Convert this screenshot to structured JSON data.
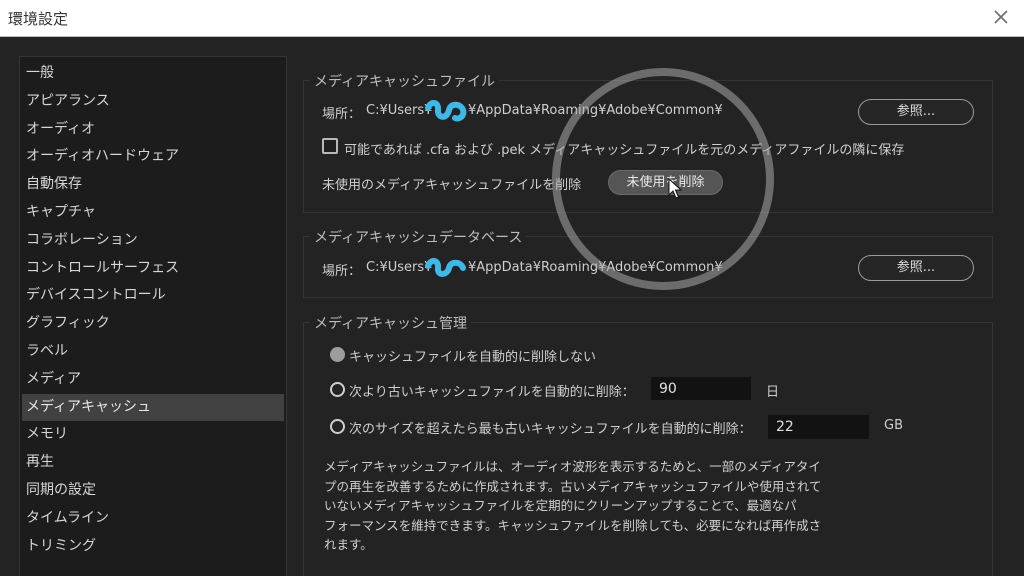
{
  "window": {
    "title": "環境設定"
  },
  "sidebar": {
    "items": [
      {
        "label": "一般",
        "active": false
      },
      {
        "label": "アピアランス",
        "active": false
      },
      {
        "label": "オーディオ",
        "active": false
      },
      {
        "label": "オーディオハードウェア",
        "active": false
      },
      {
        "label": "自動保存",
        "active": false
      },
      {
        "label": "キャプチャ",
        "active": false
      },
      {
        "label": "コラボレーション",
        "active": false
      },
      {
        "label": "コントロールサーフェス",
        "active": false
      },
      {
        "label": "デバイスコントロール",
        "active": false
      },
      {
        "label": "グラフィック",
        "active": false
      },
      {
        "label": "ラベル",
        "active": false
      },
      {
        "label": "メディア",
        "active": false
      },
      {
        "label": "メディアキャッシュ",
        "active": true
      },
      {
        "label": "メモリ",
        "active": false
      },
      {
        "label": "再生",
        "active": false
      },
      {
        "label": "同期の設定",
        "active": false
      },
      {
        "label": "タイムライン",
        "active": false
      },
      {
        "label": "トリミング",
        "active": false
      }
    ]
  },
  "media_cache_files": {
    "title": "メディアキャッシュファイル",
    "location_label": "場所：",
    "path_prefix": "C:¥Users¥",
    "path_suffix": "¥AppData¥Roaming¥Adobe¥Common¥",
    "browse_label": "参照...",
    "save_next_checkbox_label": "可能であれば .cfa および .pek メディアキャッシュファイルを元のメディアファイルの隣に保存",
    "save_next_checked": false,
    "delete_unused_label": "未使用のメディアキャッシュファイルを削除",
    "delete_unused_button": "未使用を削除"
  },
  "media_cache_db": {
    "title": "メディアキャッシュデータベース",
    "location_label": "場所：",
    "path_prefix": "C:¥Users¥",
    "path_suffix": "¥AppData¥Roaming¥Adobe¥Common¥",
    "browse_label": "参照..."
  },
  "media_cache_management": {
    "title": "メディアキャッシュ管理",
    "option_no_delete": "キャッシュファイルを自動的に削除しない",
    "option_older_than": "次より古いキャッシュファイルを自動的に削除：",
    "older_than_value": "90",
    "older_than_unit": "日",
    "option_exceeds_size": "次のサイズを超えたら最も古いキャッシュファイルを自動的に削除：",
    "size_value": "22",
    "size_unit": "GB",
    "selected_option": "no_delete",
    "description_lines": [
      "メディアキャッシュファイルは、オーディオ波形を表示するためと、一部のメディアタイ",
      "プの再生を改善するために作成されます。古いメディアキャッシュファイルや使用されて",
      "いないメディアキャッシュファイルを定期的にクリーンアップすることで、最適なパ",
      "フォーマンスを維持できます。キャッシュファイルを削除しても、必要になれば再作成さ",
      "れます。"
    ]
  },
  "colors": {
    "background": "#232323",
    "sidebar": "#1c1c1c",
    "selected_item": "#414141",
    "redaction": "#3fb8e8"
  }
}
